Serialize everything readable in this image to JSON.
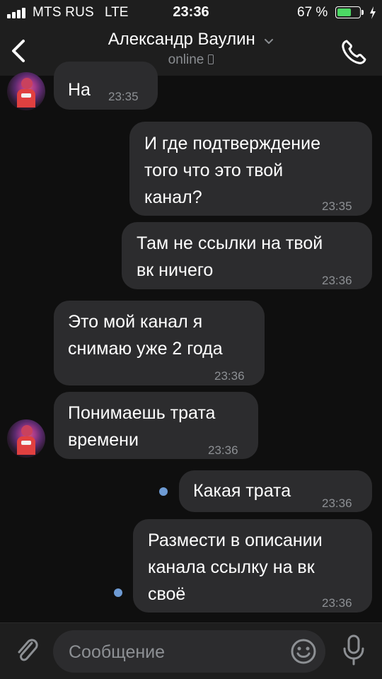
{
  "status_bar": {
    "carrier": "MTS RUS",
    "network": "LTE",
    "time": "23:36",
    "battery_percent_label": "67 %",
    "battery_level": 0.67,
    "battery_color": "#4cd964"
  },
  "header": {
    "contact_name": "Александр Ваулин",
    "presence": "online",
    "back_icon": "chevron-left-icon",
    "call_icon": "phone-icon"
  },
  "messages": [
    {
      "direction": "incoming",
      "text": "На",
      "time": "23:35",
      "avatar": true
    },
    {
      "direction": "outgoing",
      "text": "И где подтверждение\nтого что это твой\nканал?",
      "time": "23:35"
    },
    {
      "direction": "outgoing",
      "text": "Там не ссылки на твой\nвк ничего",
      "time": "23:36"
    },
    {
      "direction": "incoming",
      "text": "Это мой канал я\nснимаю уже 2 года",
      "time": "23:36"
    },
    {
      "direction": "incoming",
      "text": "Понимаешь трата\nвремени",
      "time": "23:36",
      "avatar": true
    },
    {
      "direction": "outgoing",
      "text": "Какая трата",
      "time": "23:36",
      "unread": true
    },
    {
      "direction": "outgoing",
      "text": "Размести в описании\nканала ссылку на вк\nсвоё",
      "time": "23:36",
      "unread": true
    }
  ],
  "composer": {
    "placeholder": "Сообщение",
    "value": "",
    "attach_icon": "paperclip-icon",
    "emoji_icon": "smiley-icon",
    "mic_icon": "microphone-icon"
  },
  "colors": {
    "background": "#0f0f0f",
    "bars": "#1e1e1e",
    "bubble": "#2c2c2e",
    "timestamp": "#8d9094",
    "unread_dot": "#6e9bd4",
    "subtitle": "#8a8d91"
  }
}
